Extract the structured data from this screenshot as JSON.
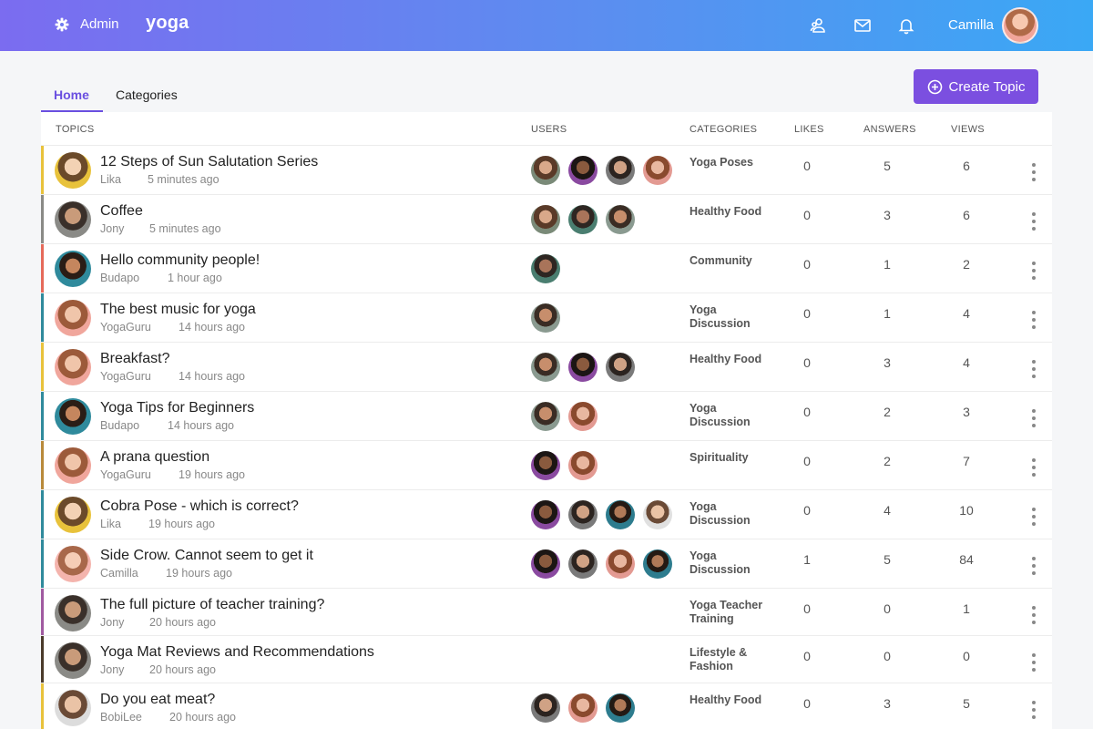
{
  "header": {
    "admin_label": "Admin",
    "brand": "yoga",
    "user_name": "Camilla"
  },
  "tabs": [
    {
      "label": "Home",
      "active": true
    },
    {
      "label": "Categories",
      "active": false
    }
  ],
  "create_button_label": "Create Topic",
  "columns": {
    "topics": "TOPICS",
    "users": "USERS",
    "categories": "CATEGORIES",
    "likes": "LIKES",
    "answers": "ANSWERS",
    "views": "VIEWS"
  },
  "colors": {
    "accent": "#6a4fe0",
    "button": "#7b4fe0",
    "header_start": "#7b6cf0",
    "header_end": "#3aa8f5"
  },
  "topics": [
    {
      "title": "12 Steps of Sun Salutation Series",
      "author": "Lika",
      "time": "5 minutes ago",
      "category": "Yoga Poses",
      "likes": "0",
      "answers": "5",
      "views": "6"
    },
    {
      "title": "Coffee",
      "author": "Jony",
      "time": "5 minutes ago",
      "category": "Healthy Food",
      "likes": "0",
      "answers": "3",
      "views": "6"
    },
    {
      "title": "Hello community people!",
      "author": "Budapo",
      "time": "1 hour ago",
      "category": "Community",
      "likes": "0",
      "answers": "1",
      "views": "2"
    },
    {
      "title": "The best music for yoga",
      "author": "YogaGuru",
      "time": "14 hours ago",
      "category": "Yoga Discussion",
      "likes": "0",
      "answers": "1",
      "views": "4"
    },
    {
      "title": "Breakfast?",
      "author": "YogaGuru",
      "time": "14 hours ago",
      "category": "Healthy Food",
      "likes": "0",
      "answers": "3",
      "views": "4"
    },
    {
      "title": "Yoga Tips for Beginners",
      "author": "Budapo",
      "time": "14 hours ago",
      "category": "Yoga Discussion",
      "likes": "0",
      "answers": "2",
      "views": "3"
    },
    {
      "title": "A prana question",
      "author": "YogaGuru",
      "time": "19 hours ago",
      "category": "Spirituality",
      "likes": "0",
      "answers": "2",
      "views": "7"
    },
    {
      "title": "Cobra Pose - which is correct?",
      "author": "Lika",
      "time": "19 hours ago",
      "category": "Yoga Discussion",
      "likes": "0",
      "answers": "4",
      "views": "10"
    },
    {
      "title": "Side Crow. Cannot seem to get it",
      "author": "Camilla",
      "time": "19 hours ago",
      "category": "Yoga Discussion",
      "likes": "1",
      "answers": "5",
      "views": "84"
    },
    {
      "title": "The full picture of teacher training?",
      "author": "Jony",
      "time": "20 hours ago",
      "category": "Yoga Teacher Training",
      "likes": "0",
      "answers": "0",
      "views": "1"
    },
    {
      "title": "Yoga Mat Reviews and Recommendations",
      "author": "Jony",
      "time": "20 hours ago",
      "category": "Lifestyle & Fashion",
      "likes": "0",
      "answers": "0",
      "views": "0"
    },
    {
      "title": "Do you eat meat?",
      "author": "BobiLee",
      "time": "20 hours ago",
      "category": "Healthy Food",
      "likes": "0",
      "answers": "3",
      "views": "5"
    }
  ]
}
